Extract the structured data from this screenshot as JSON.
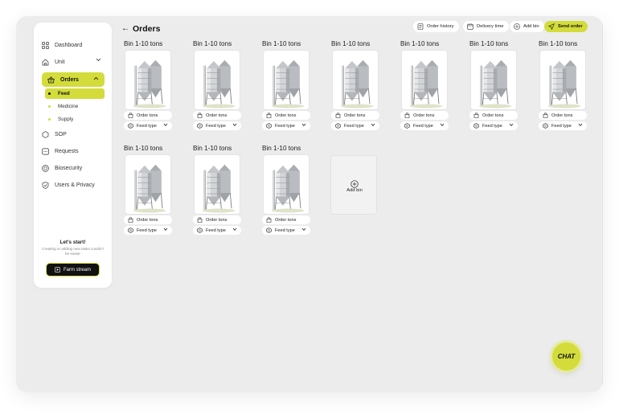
{
  "header": {
    "title": "Orders",
    "buttons": {
      "order_history": "Order history",
      "delivery_time": "Delivery time",
      "add_bin": "Add bin",
      "send_order": "Send order"
    }
  },
  "sidebar": {
    "items": [
      {
        "label": "Dashboard",
        "icon": "grid-icon"
      },
      {
        "label": "Unit",
        "icon": "home-icon"
      },
      {
        "label": "Orders",
        "icon": "basket-icon"
      },
      {
        "label": "SOP",
        "icon": "hexagon-icon"
      },
      {
        "label": "Requests",
        "icon": "chat-box-icon"
      },
      {
        "label": "Biosecurity",
        "icon": "shield-icon"
      },
      {
        "label": "Users & Privacy",
        "icon": "check-shield-icon"
      }
    ],
    "sub_items": [
      "Feed",
      "Medicine",
      "Supply"
    ],
    "cta": {
      "title": "Let's start!",
      "subtitle": "Creating or adding new tasks couldn't be easier",
      "button": "Farm stream"
    }
  },
  "bins": [
    {
      "label": "Bin 1-10 tons",
      "order": "Order tons",
      "feed": "Feed type"
    },
    {
      "label": "Bin 1-10 tons",
      "order": "Order tons",
      "feed": "Feed type"
    },
    {
      "label": "Bin 1-10 tons",
      "order": "Order tons",
      "feed": "Feed type"
    },
    {
      "label": "Bin 1-10 tons",
      "order": "Order tons",
      "feed": "Feed type"
    },
    {
      "label": "Bin 1-10 tons",
      "order": "Order tons",
      "feed": "Feed type"
    },
    {
      "label": "Bin 1-10 tons",
      "order": "Order tons",
      "feed": "Feed type"
    },
    {
      "label": "Bin 1-10 tons",
      "order": "Order tons",
      "feed": "Feed type"
    },
    {
      "label": "Bin 1-10 tons",
      "order": "Order tons",
      "feed": "Feed type"
    },
    {
      "label": "Bin 1-10 tons",
      "order": "Order tons",
      "feed": "Feed type"
    },
    {
      "label": "Bin 1-10 tons",
      "order": "Order tons",
      "feed": "Feed type"
    }
  ],
  "add_bin_card": {
    "label": "Add bin"
  },
  "chat": {
    "label": "CHAT"
  },
  "colors": {
    "accent": "#d3dc3a",
    "background": "#ececec",
    "card": "#ffffff",
    "dark": "#111111"
  }
}
